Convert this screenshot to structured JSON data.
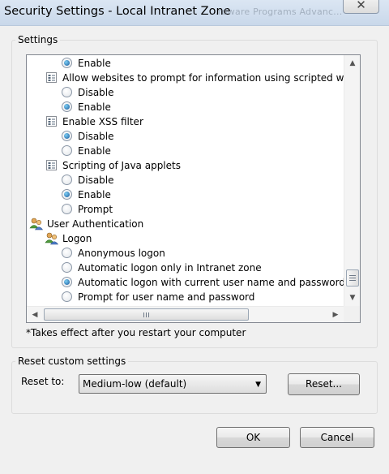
{
  "window": {
    "title": "Security Settings - Local Intranet Zone",
    "background_tabs": "...rdware   Programs   Advanc...",
    "close_glyph": "✕"
  },
  "settings": {
    "legend": "Settings",
    "tree": [
      {
        "kind": "radio",
        "label": "Enable",
        "checked": true
      },
      {
        "kind": "setting",
        "label": "Allow websites to prompt for information using scripted windows",
        "icon": "settings-icon"
      },
      {
        "kind": "radio",
        "label": "Disable",
        "checked": false
      },
      {
        "kind": "radio",
        "label": "Enable",
        "checked": true
      },
      {
        "kind": "setting",
        "label": "Enable XSS filter",
        "icon": "settings-icon"
      },
      {
        "kind": "radio",
        "label": "Disable",
        "checked": true
      },
      {
        "kind": "radio",
        "label": "Enable",
        "checked": false
      },
      {
        "kind": "setting",
        "label": "Scripting of Java applets",
        "icon": "settings-icon"
      },
      {
        "kind": "radio",
        "label": "Disable",
        "checked": false
      },
      {
        "kind": "radio",
        "label": "Enable",
        "checked": true
      },
      {
        "kind": "radio",
        "label": "Prompt",
        "checked": false
      },
      {
        "kind": "category",
        "label": "User Authentication",
        "icon": "users-icon"
      },
      {
        "kind": "subcategory",
        "label": "Logon",
        "icon": "users-icon"
      },
      {
        "kind": "radio",
        "label": "Anonymous logon",
        "checked": false
      },
      {
        "kind": "radio",
        "label": "Automatic logon only in Intranet zone",
        "checked": false
      },
      {
        "kind": "radio",
        "label": "Automatic logon with current user name and password",
        "checked": true
      },
      {
        "kind": "radio",
        "label": "Prompt for user name and password",
        "checked": false
      }
    ],
    "note": "*Takes effect after you restart your computer"
  },
  "reset": {
    "legend": "Reset custom settings",
    "label": "Reset to:",
    "selected": "Medium-low (default)",
    "button": "Reset..."
  },
  "dialog": {
    "ok": "OK",
    "cancel": "Cancel"
  }
}
